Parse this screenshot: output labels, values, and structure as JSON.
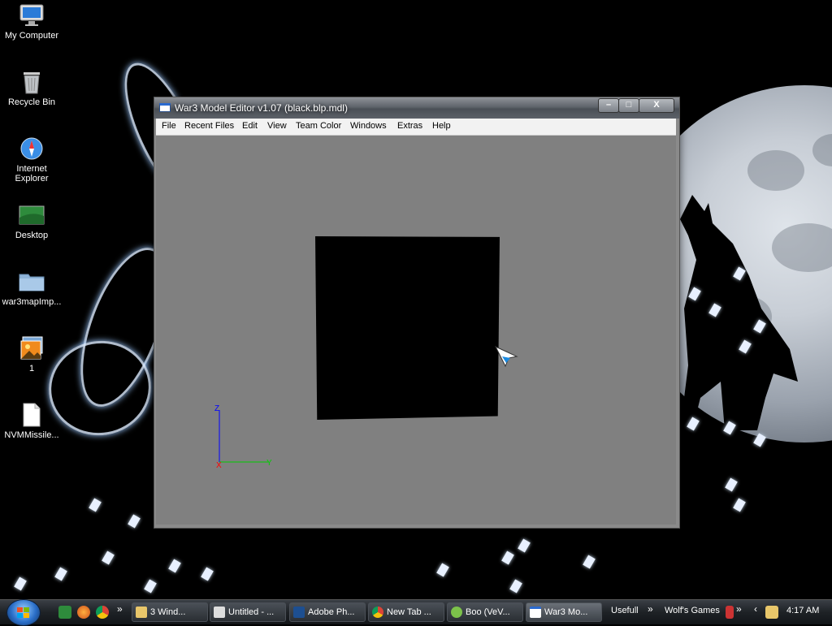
{
  "desktop": {
    "icons": [
      {
        "label": "My Computer",
        "icon": "monitor-icon"
      },
      {
        "label": "Recycle Bin",
        "icon": "recycle-bin-icon"
      },
      {
        "label": "Internet Explorer",
        "icon": "compass-icon"
      },
      {
        "label": "Desktop",
        "icon": "desktop-image-icon"
      },
      {
        "label": "war3mapImp...",
        "icon": "folder-icon"
      },
      {
        "label": "1",
        "icon": "photo-icon"
      },
      {
        "label": "NVMMissile...",
        "icon": "file-icon"
      }
    ]
  },
  "window": {
    "title": "War3 Model Editor v1.07 (black.blp.mdl)",
    "menu": [
      "File",
      "Recent Files",
      "Edit",
      "View",
      "Team Color",
      "Windows",
      "Extras",
      "Help"
    ],
    "controls": {
      "minimize": "–",
      "maximize": "□",
      "close": "X"
    },
    "axes": {
      "z": "Z",
      "x": "X",
      "y": "Y"
    },
    "colors": {
      "viewport": "#808080",
      "z_axis": "#0000ff",
      "x_axis": "#ff0000",
      "y_axis": "#00cc00"
    }
  },
  "taskbar": {
    "quick_launch": [
      "show-desktop-icon",
      "firefox-icon",
      "chrome-icon"
    ],
    "buttons": [
      {
        "label": "3 Wind...",
        "icon": "folder-icon"
      },
      {
        "label": "Untitled - ...",
        "icon": "paint-icon"
      },
      {
        "label": "Adobe Ph...",
        "icon": "photoshop-icon"
      },
      {
        "label": "New Tab ...",
        "icon": "chrome-icon"
      },
      {
        "label": "Boo (VeV...",
        "icon": "messenger-icon"
      },
      {
        "label": "War3 Mo...",
        "icon": "window-icon"
      }
    ],
    "toolbars": [
      "Usefull",
      "Wolf's Games"
    ],
    "clock": "4:17 AM"
  }
}
